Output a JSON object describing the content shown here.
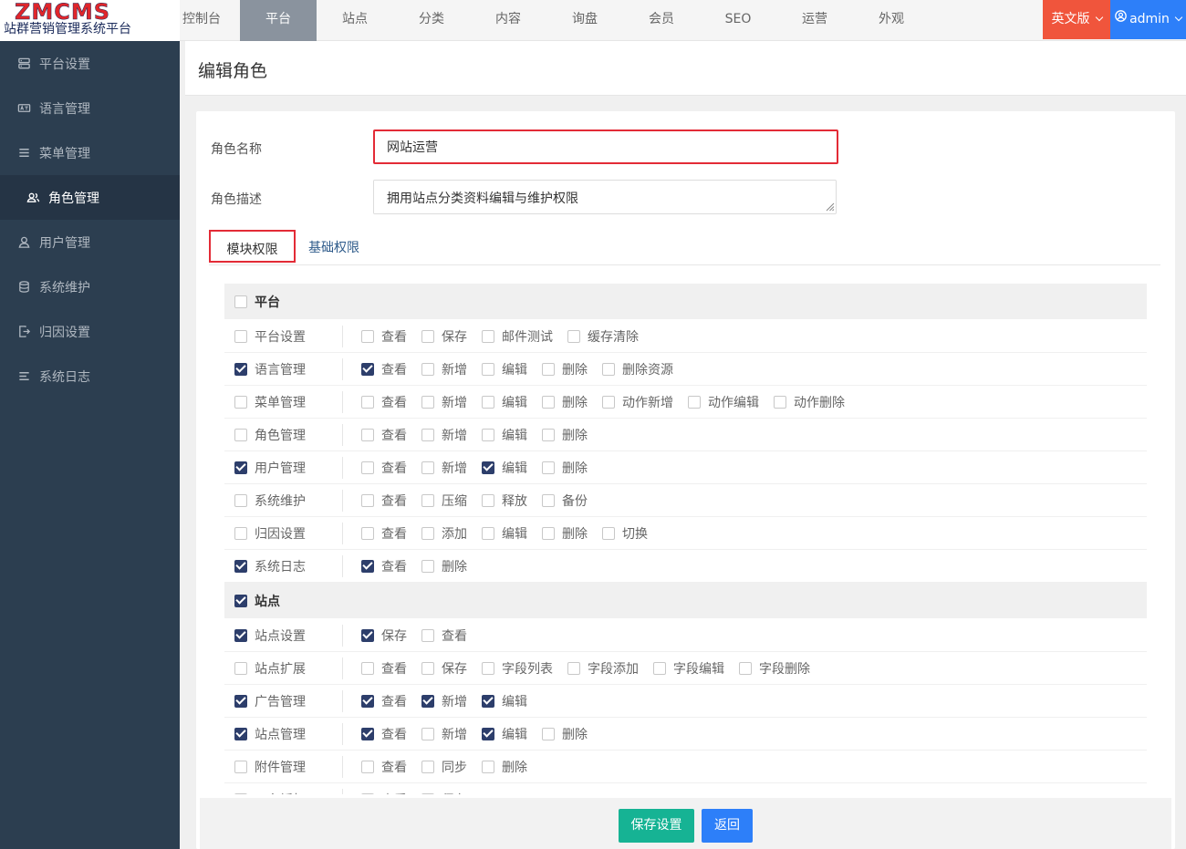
{
  "brand": {
    "logo": "ZMCMS",
    "subtitle": "站群营销管理系统平台"
  },
  "nav": [
    "控制台",
    "平台",
    "站点",
    "分类",
    "内容",
    "询盘",
    "会员",
    "SEO",
    "运营",
    "外观"
  ],
  "nav_active": 1,
  "lang_button": "英文版",
  "user_button": "admin",
  "sidebar": [
    {
      "label": "平台设置",
      "icon": "server-icon"
    },
    {
      "label": "语言管理",
      "icon": "language-icon"
    },
    {
      "label": "菜单管理",
      "icon": "menu-icon"
    },
    {
      "label": "角色管理",
      "icon": "users-icon",
      "active": true
    },
    {
      "label": "用户管理",
      "icon": "user-icon"
    },
    {
      "label": "系统维护",
      "icon": "database-icon"
    },
    {
      "label": "归因设置",
      "icon": "export-icon"
    },
    {
      "label": "系统日志",
      "icon": "log-icon"
    }
  ],
  "page_title": "编辑角色",
  "form": {
    "name_label": "角色名称",
    "name_value": "网站运营",
    "desc_label": "角色描述",
    "desc_value": "拥用站点分类资料编辑与维护权限"
  },
  "tabs": [
    "模块权限",
    "基础权限"
  ],
  "groups": [
    {
      "name": "平台",
      "checked": false,
      "rows": [
        {
          "name": "平台设置",
          "checked": false,
          "actions": [
            [
              "查看",
              false
            ],
            [
              "保存",
              false
            ],
            [
              "邮件测试",
              false
            ],
            [
              "缓存清除",
              false
            ]
          ]
        },
        {
          "name": "语言管理",
          "checked": true,
          "actions": [
            [
              "查看",
              true
            ],
            [
              "新增",
              false
            ],
            [
              "编辑",
              false
            ],
            [
              "删除",
              false
            ],
            [
              "删除资源",
              false
            ]
          ]
        },
        {
          "name": "菜单管理",
          "checked": false,
          "actions": [
            [
              "查看",
              false
            ],
            [
              "新增",
              false
            ],
            [
              "编辑",
              false
            ],
            [
              "删除",
              false
            ],
            [
              "动作新增",
              false
            ],
            [
              "动作编辑",
              false
            ],
            [
              "动作删除",
              false
            ]
          ]
        },
        {
          "name": "角色管理",
          "checked": false,
          "actions": [
            [
              "查看",
              false
            ],
            [
              "新增",
              false
            ],
            [
              "编辑",
              false
            ],
            [
              "删除",
              false
            ]
          ]
        },
        {
          "name": "用户管理",
          "checked": true,
          "actions": [
            [
              "查看",
              false
            ],
            [
              "新增",
              false
            ],
            [
              "编辑",
              true
            ],
            [
              "删除",
              false
            ]
          ]
        },
        {
          "name": "系统维护",
          "checked": false,
          "actions": [
            [
              "查看",
              false
            ],
            [
              "压缩",
              false
            ],
            [
              "释放",
              false
            ],
            [
              "备份",
              false
            ]
          ]
        },
        {
          "name": "归因设置",
          "checked": false,
          "actions": [
            [
              "查看",
              false
            ],
            [
              "添加",
              false
            ],
            [
              "编辑",
              false
            ],
            [
              "删除",
              false
            ],
            [
              "切换",
              false
            ]
          ]
        },
        {
          "name": "系统日志",
          "checked": true,
          "actions": [
            [
              "查看",
              true
            ],
            [
              "删除",
              false
            ]
          ]
        }
      ]
    },
    {
      "name": "站点",
      "checked": true,
      "rows": [
        {
          "name": "站点设置",
          "checked": true,
          "actions": [
            [
              "保存",
              true
            ],
            [
              "查看",
              false
            ]
          ]
        },
        {
          "name": "站点扩展",
          "checked": false,
          "actions": [
            [
              "查看",
              false
            ],
            [
              "保存",
              false
            ],
            [
              "字段列表",
              false
            ],
            [
              "字段添加",
              false
            ],
            [
              "字段编辑",
              false
            ],
            [
              "字段删除",
              false
            ]
          ]
        },
        {
          "name": "广告管理",
          "checked": true,
          "actions": [
            [
              "查看",
              true
            ],
            [
              "新增",
              true
            ],
            [
              "编辑",
              true
            ]
          ]
        },
        {
          "name": "站点管理",
          "checked": true,
          "actions": [
            [
              "查看",
              true
            ],
            [
              "新增",
              false
            ],
            [
              "编辑",
              true
            ],
            [
              "删除",
              false
            ]
          ]
        },
        {
          "name": "附件管理",
          "checked": false,
          "actions": [
            [
              "查看",
              false
            ],
            [
              "同步",
              false
            ],
            [
              "删除",
              false
            ]
          ]
        },
        {
          "name": "平台授权",
          "checked": false,
          "actions": [
            [
              "查看",
              false
            ],
            [
              "保存",
              false
            ]
          ]
        }
      ]
    }
  ],
  "buttons": {
    "save": "保存设置",
    "back": "返回"
  },
  "colors": {
    "sidebar_bg": "#2c3e50",
    "lang_btn": "#f0553c",
    "user_btn": "#2d7ff9",
    "save_btn": "#16b394",
    "checkbox_on": "#2d3e6b",
    "highlight": "#e32b36"
  }
}
